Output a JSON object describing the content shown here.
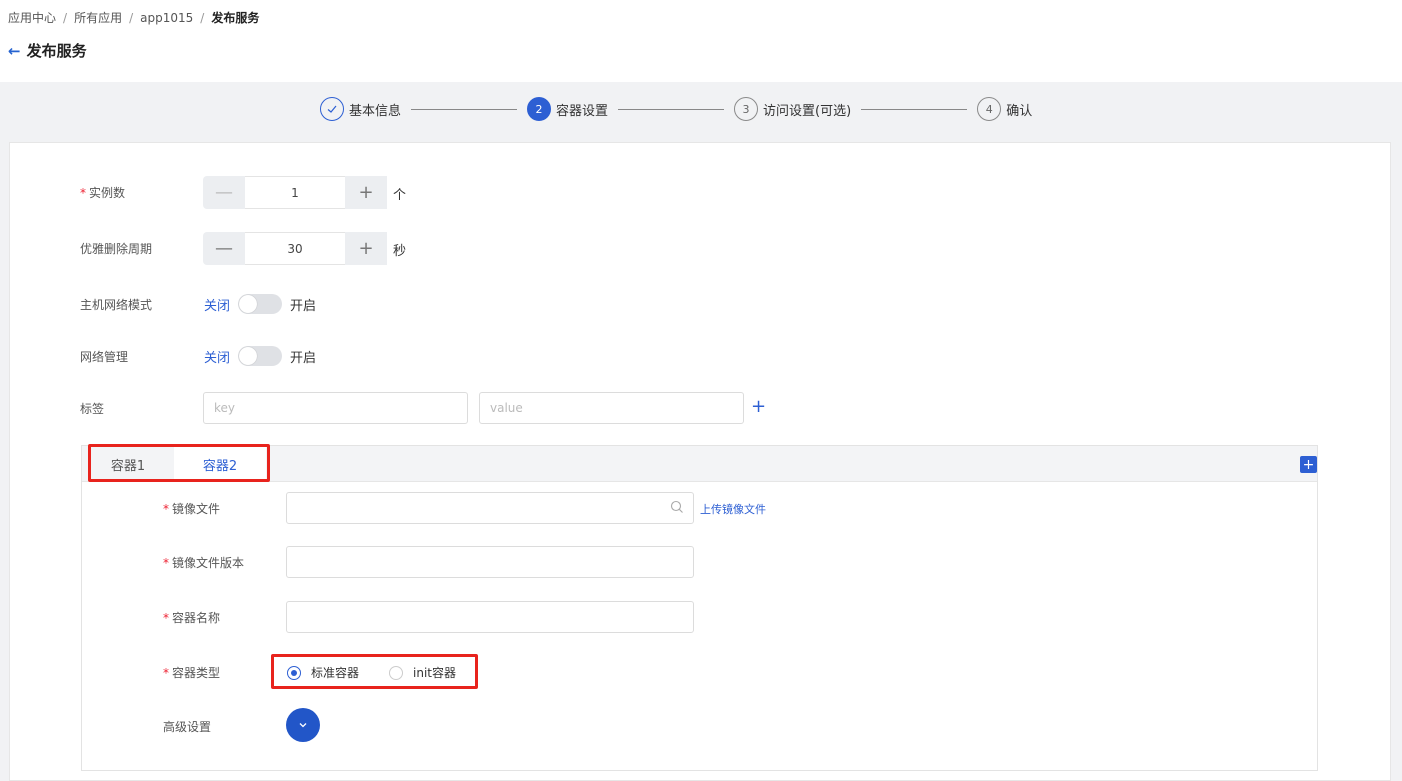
{
  "breadcrumb": {
    "items": [
      "应用中心",
      "所有应用",
      "app1015"
    ],
    "current": "发布服务",
    "separator": "/"
  },
  "page": {
    "title": "发布服务"
  },
  "steps": [
    {
      "num": "✓",
      "label": "基本信息",
      "state": "done"
    },
    {
      "num": "2",
      "label": "容器设置",
      "state": "active"
    },
    {
      "num": "3",
      "label": "访问设置(可选)",
      "state": "pending"
    },
    {
      "num": "4",
      "label": "确认",
      "state": "pending"
    }
  ],
  "form": {
    "instances": {
      "label": "实例数",
      "required": "*",
      "value": "1",
      "unit": "个"
    },
    "grace_period": {
      "label": "优雅删除周期",
      "value": "30",
      "unit": "秒"
    },
    "host_network": {
      "label": "主机网络模式",
      "off": "关闭",
      "on": "开启"
    },
    "network_mgmt": {
      "label": "网络管理",
      "off": "关闭",
      "on": "开启"
    },
    "tags": {
      "label": "标签",
      "key_placeholder": "key",
      "value_placeholder": "value"
    }
  },
  "containers": {
    "tabs": [
      "容器1",
      "容器2"
    ],
    "active_tab": 1,
    "image_file": {
      "label": "镜像文件",
      "required": "*",
      "upload_link": "上传镜像文件"
    },
    "image_version": {
      "label": "镜像文件版本",
      "required": "*"
    },
    "container_name": {
      "label": "容器名称",
      "required": "*"
    },
    "container_type": {
      "label": "容器类型",
      "required": "*",
      "options": [
        "标准容器",
        "init容器"
      ],
      "selected": "标准容器"
    },
    "advanced": {
      "label": "高级设置"
    }
  },
  "colors": {
    "accent": "#2d5fd3",
    "highlight": "#e8231d"
  }
}
